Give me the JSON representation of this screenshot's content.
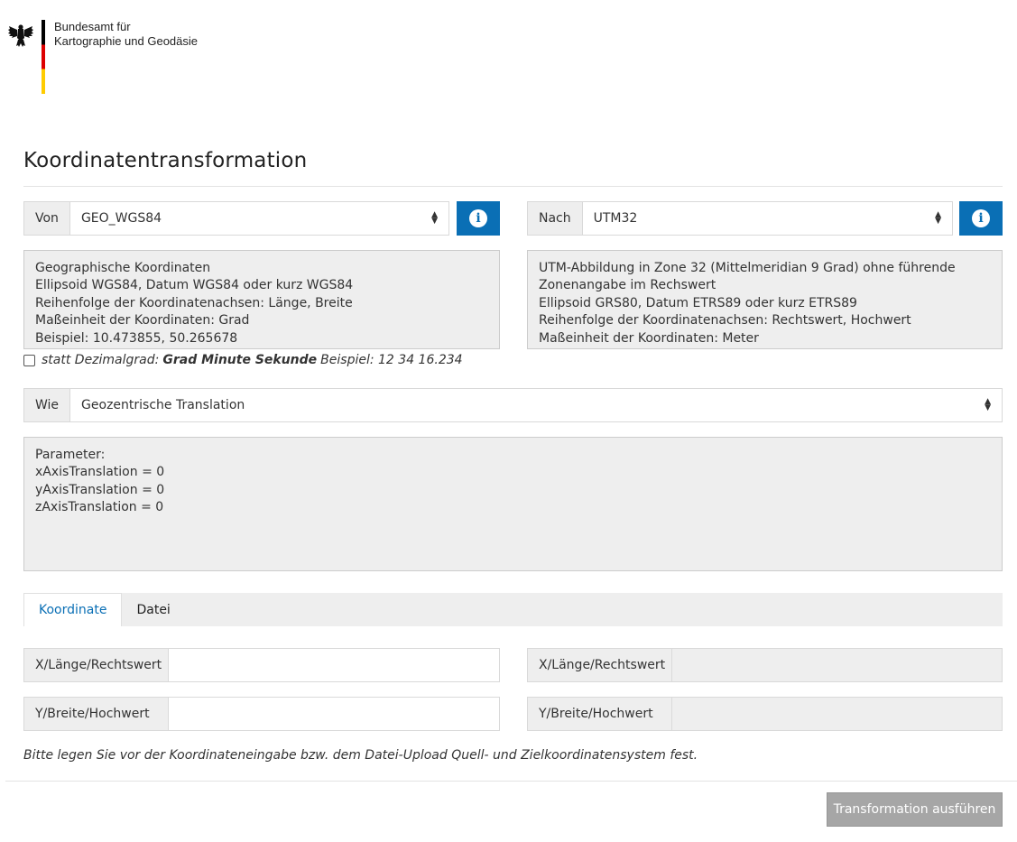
{
  "header": {
    "org_line1": "Bundesamt für",
    "org_line2": "Kartographie und Geodäsie",
    "logo_icon": "federal-eagle-icon",
    "flag_colors": [
      "#000000",
      "#dd0000",
      "#ffcc00"
    ]
  },
  "page_title": "Koordinatentransformation",
  "source": {
    "label": "Von",
    "selected": "GEO_WGS84",
    "info_icon": "info-icon",
    "description": [
      "Geographische Koordinaten",
      "Ellipsoid WGS84, Datum WGS84 oder kurz  WGS84",
      "Reihenfolge der Koordinatenachsen:  Länge, Breite",
      "Maßeinheit der Koordinaten:  Grad",
      "Beispiel:  10.473855, 50.265678"
    ]
  },
  "target": {
    "label": "Nach",
    "selected": "UTM32",
    "info_icon": "info-icon",
    "description": [
      "UTM-Abbildung in Zone 32  (Mittelmeridian 9 Grad)  ohne führende",
      "Zonenangabe im Rechswert",
      "Ellipsoid GRS80, Datum ETRS89 oder kurz  ETRS89",
      "Reihenfolge der Koordinatenachsen:  Rechtswert, Hochwert",
      "Maßeinheit der Koordinaten:  Meter"
    ]
  },
  "dms_option": {
    "prefix": "statt Dezimalgrad:",
    "bold": "Grad Minute Sekunde",
    "suffix": "Beispiel: 12 34 16.234",
    "checked": false
  },
  "method": {
    "label": "Wie",
    "selected": "Geozentrische Translation",
    "parameters": [
      "Parameter:",
      "xAxisTranslation = 0",
      "yAxisTranslation = 0",
      "zAxisTranslation = 0"
    ]
  },
  "tabs": [
    {
      "label": "Koordinate",
      "active": true
    },
    {
      "label": "Datei",
      "active": false
    }
  ],
  "input_fields": {
    "x_label": "X/Länge/Rechtswert",
    "x_value": "",
    "y_label": "Y/Breite/Hochwert",
    "y_value": ""
  },
  "output_fields": {
    "x_label": "X/Länge/Rechtswert",
    "x_value": "",
    "y_label": "Y/Breite/Hochwert",
    "y_value": ""
  },
  "note": "Bitte legen Sie vor der Koordinateneingabe bzw. dem Datei-Upload Quell- und Zielkoordinatensystem fest.",
  "run_button": "Transformation ausführen",
  "colors": {
    "accent": "#0a6fb5",
    "panel": "#eeeeee",
    "disabled_button": "#a6a6a6"
  }
}
